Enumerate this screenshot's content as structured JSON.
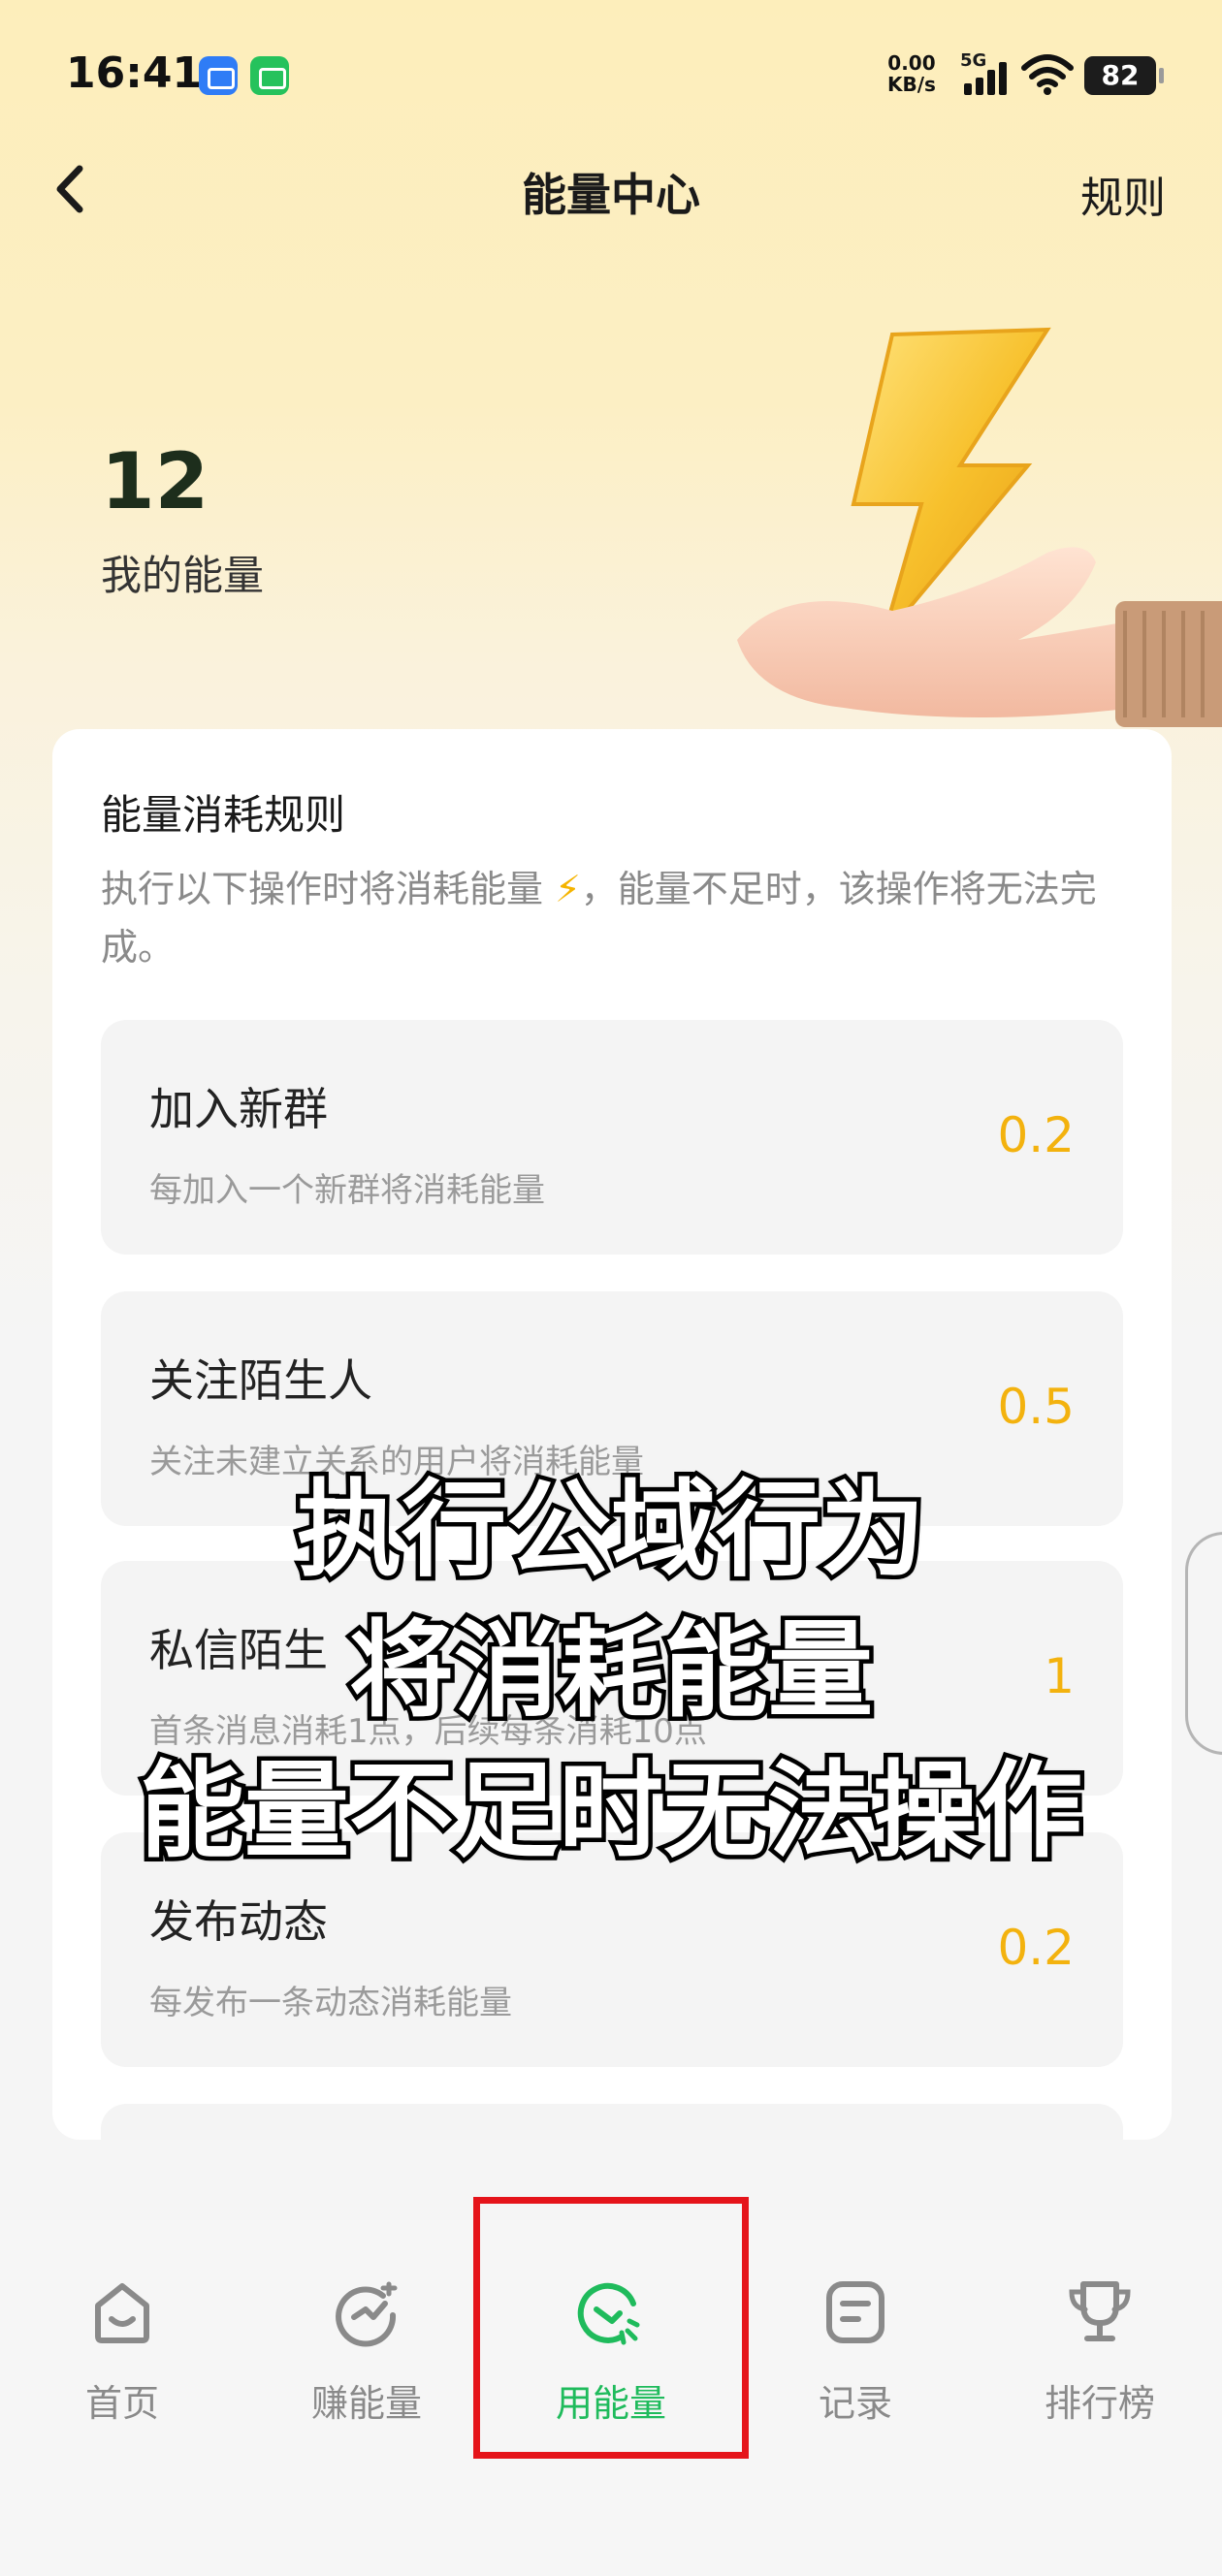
{
  "status_bar": {
    "time": "16:41",
    "net_speed_value": "0.00",
    "net_speed_unit": "KB/s",
    "network": "5G",
    "battery": "82"
  },
  "header": {
    "title": "能量中心",
    "rules_label": "规则"
  },
  "energy": {
    "value": "12",
    "label": "我的能量"
  },
  "card": {
    "title": "能量消耗规则",
    "desc_before": "执行以下操作时将消耗能量 ",
    "desc_bolt": "⚡",
    "desc_after": "，能量不足时，该操作将无法完成。",
    "items": [
      {
        "name": "加入新群",
        "desc": "每加入一个新群将消耗能量",
        "cost": "0.2"
      },
      {
        "name": "关注陌生人",
        "desc": "关注未建立关系的用户将消耗能量",
        "cost": "0.5"
      },
      {
        "name": "私信陌生",
        "desc": "首条消息消耗1点，后续每条消耗10点",
        "cost": "1"
      },
      {
        "name": "发布动态",
        "desc": "每发布一条动态消耗能量",
        "cost": "0.2"
      }
    ]
  },
  "caption": {
    "line1": "执行公域行为",
    "line2": "将消耗能量",
    "line3": "能量不足时无法操作"
  },
  "tabs": [
    {
      "label": "首页",
      "icon": "home-icon"
    },
    {
      "label": "赚能量",
      "icon": "earn-energy-icon"
    },
    {
      "label": "用能量",
      "icon": "use-energy-icon"
    },
    {
      "label": "记录",
      "icon": "record-icon"
    },
    {
      "label": "排行榜",
      "icon": "trophy-icon"
    }
  ],
  "colors": {
    "accent_green": "#1fbb5c",
    "cost_yellow": "#f3b20e",
    "highlight_red": "#e5141a"
  }
}
